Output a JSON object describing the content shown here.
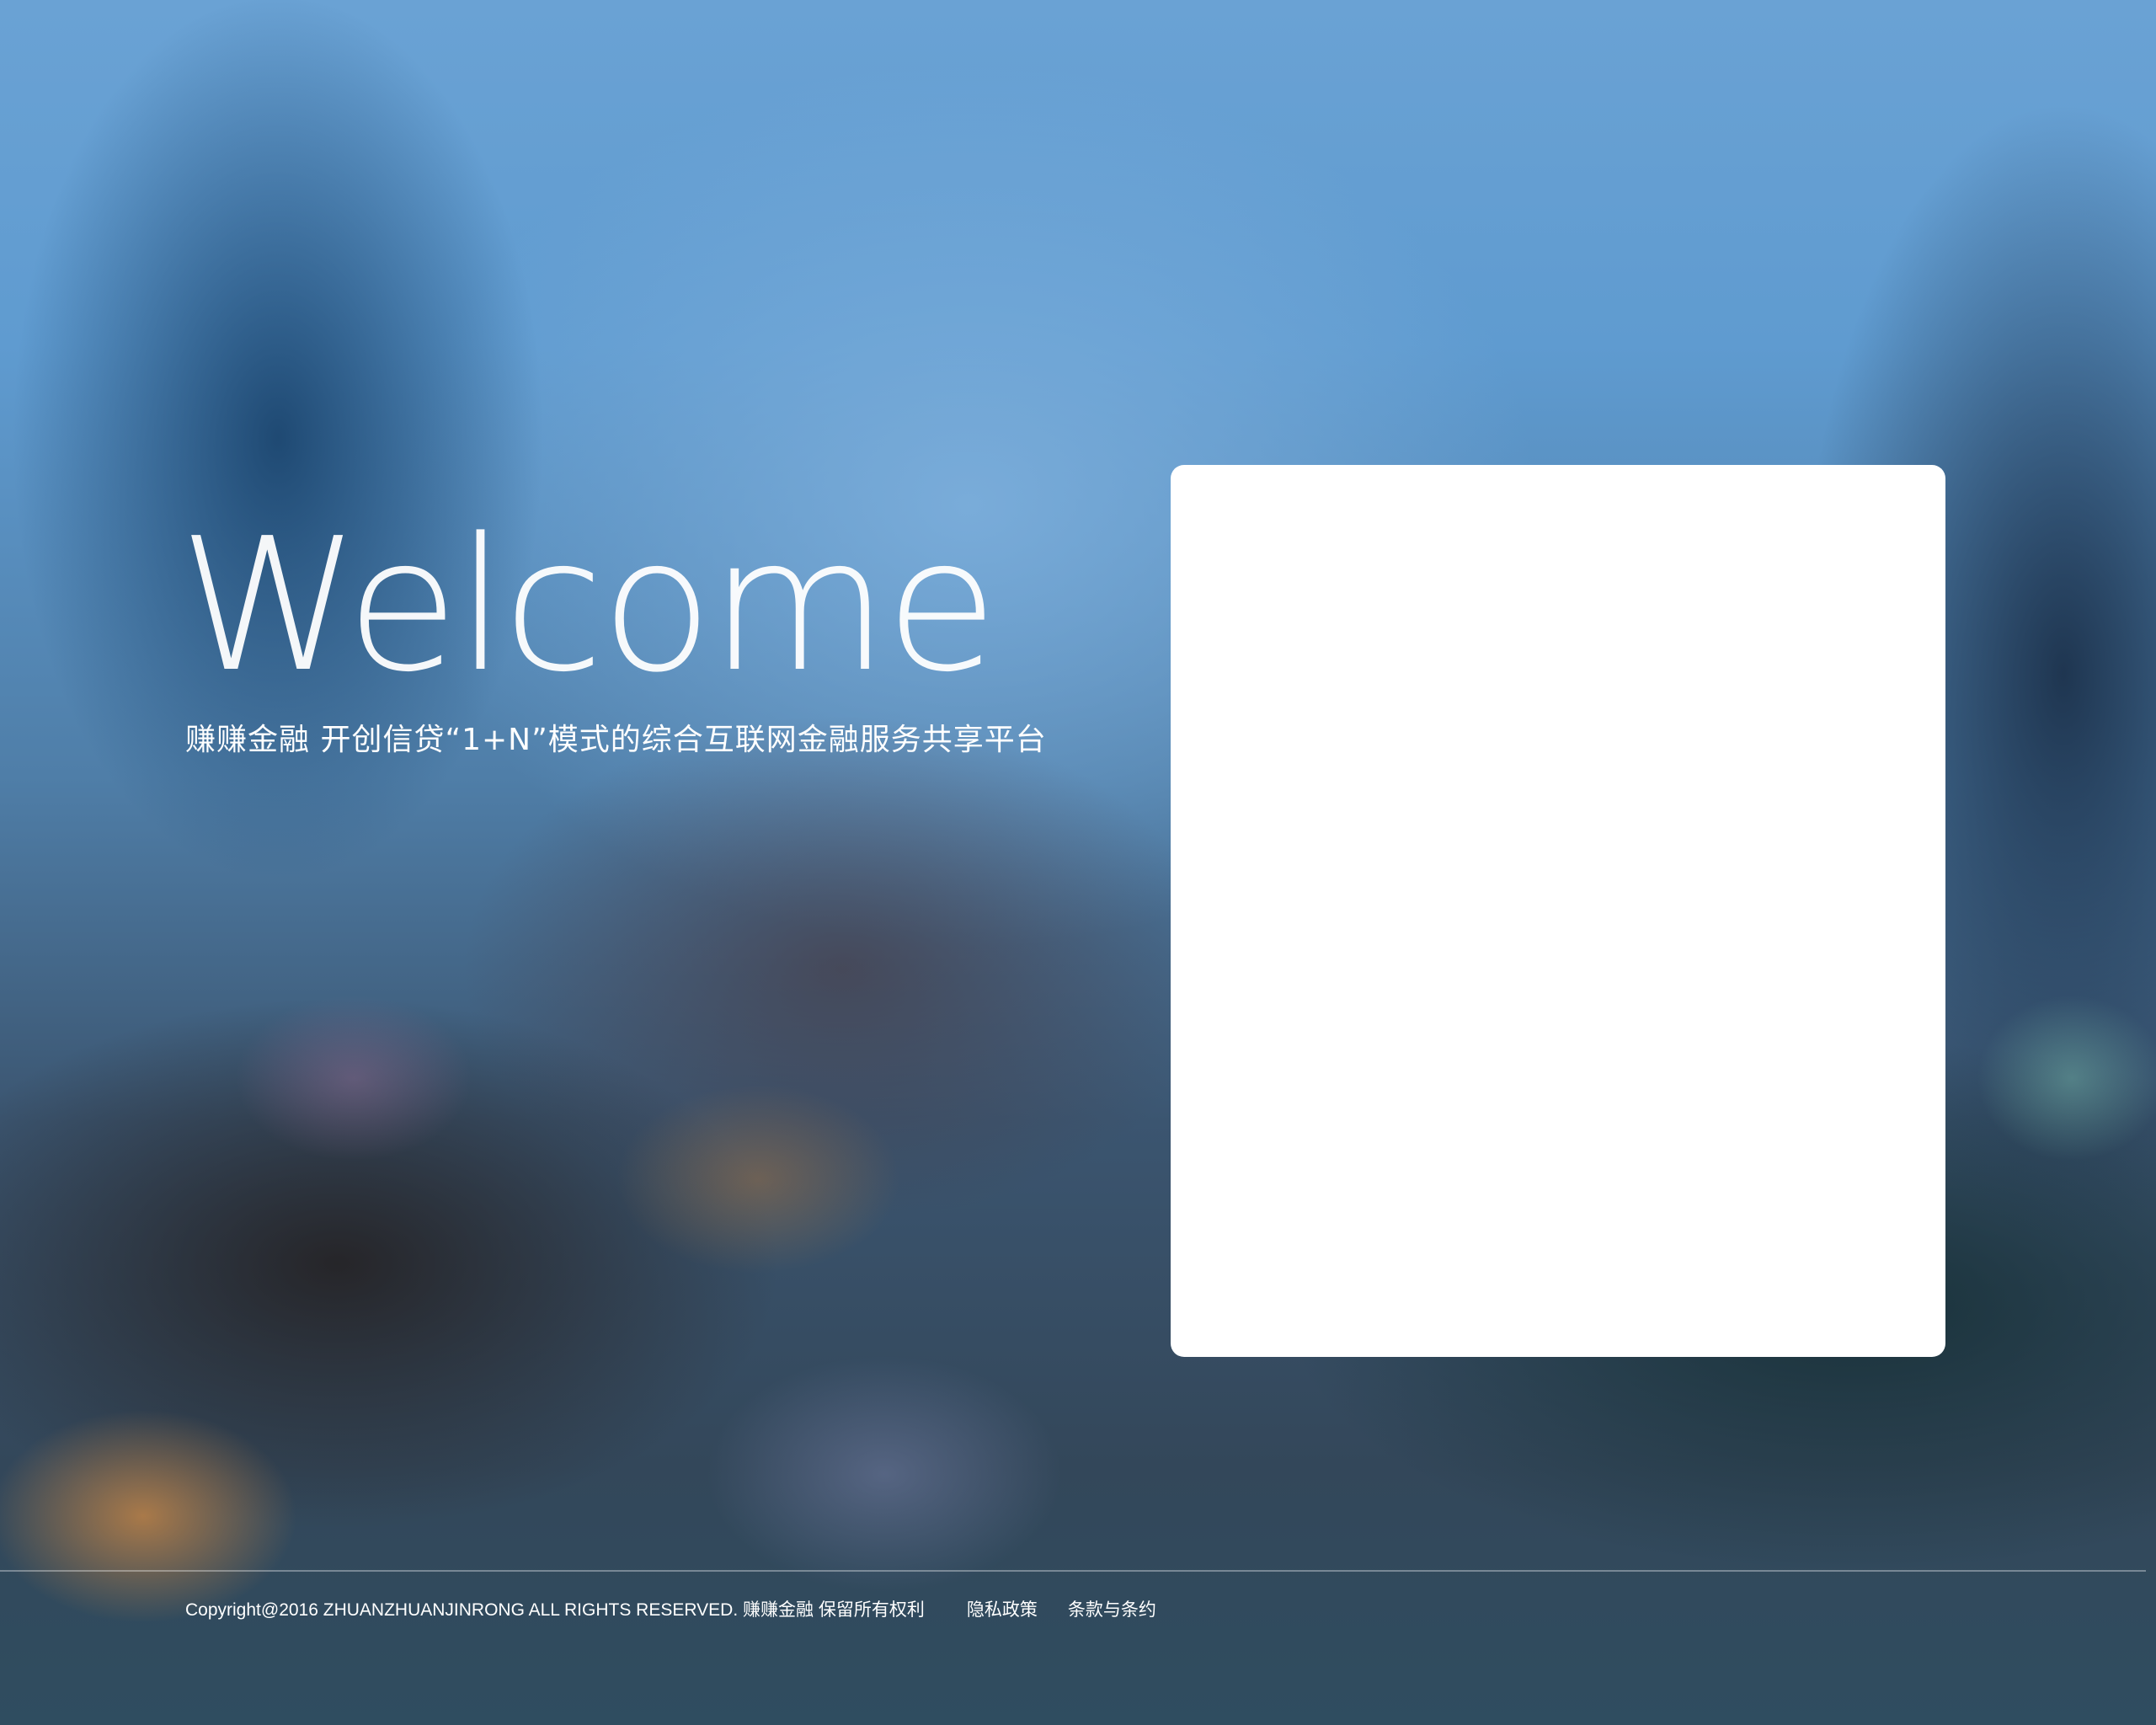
{
  "hero": {
    "title": "Welcome",
    "subtitle": "赚赚金融  开创信贷“1+N”模式的综合互联网金融服务共享平台"
  },
  "footer": {
    "copyright": "Copyright@2016 ZHUANZHUANJINRONG ALL RIGHTS RESERVED. 赚赚金融 保留所有权利",
    "links": [
      {
        "label": "隐私政策"
      },
      {
        "label": "条款与条约"
      }
    ]
  }
}
